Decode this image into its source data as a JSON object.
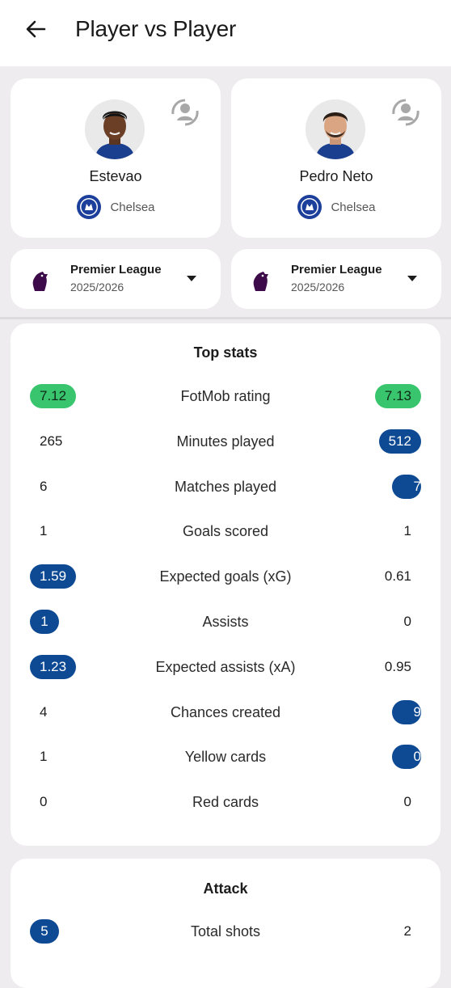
{
  "header": {
    "title": "Player vs Player"
  },
  "players": [
    {
      "name": "Estevao",
      "team": "Chelsea",
      "league": "Premier League",
      "season": "2025/2026"
    },
    {
      "name": "Pedro Neto",
      "team": "Chelsea",
      "league": "Premier League",
      "season": "2025/2026"
    }
  ],
  "top_stats": {
    "title": "Top stats",
    "rows": [
      {
        "label": "FotMob rating",
        "left": "7.12",
        "right": "7.13",
        "highlight": "both"
      },
      {
        "label": "Minutes played",
        "left": "265",
        "right": "512",
        "highlight": "right"
      },
      {
        "label": "Matches played",
        "left": "6",
        "right": "7",
        "highlight": "right"
      },
      {
        "label": "Goals scored",
        "left": "1",
        "right": "1",
        "highlight": "none"
      },
      {
        "label": "Expected goals (xG)",
        "left": "1.59",
        "right": "0.61",
        "highlight": "left"
      },
      {
        "label": "Assists",
        "left": "1",
        "right": "0",
        "highlight": "left"
      },
      {
        "label": "Expected assists (xA)",
        "left": "1.23",
        "right": "0.95",
        "highlight": "left"
      },
      {
        "label": "Chances created",
        "left": "4",
        "right": "9",
        "highlight": "right"
      },
      {
        "label": "Yellow cards",
        "left": "1",
        "right": "0",
        "highlight": "right"
      },
      {
        "label": "Red cards",
        "left": "0",
        "right": "0",
        "highlight": "none"
      }
    ]
  },
  "attack": {
    "title": "Attack",
    "rows": [
      {
        "label": "Total shots",
        "left": "5",
        "right": "2",
        "highlight": "left"
      }
    ]
  },
  "colors": {
    "highlight_blue": "#0e4a93",
    "rating_green": "#39c56e",
    "background": "#eeecee"
  },
  "icons": {
    "back": "arrow-left-icon",
    "swap": "swap-player-icon",
    "dropdown": "caret-down-icon"
  }
}
